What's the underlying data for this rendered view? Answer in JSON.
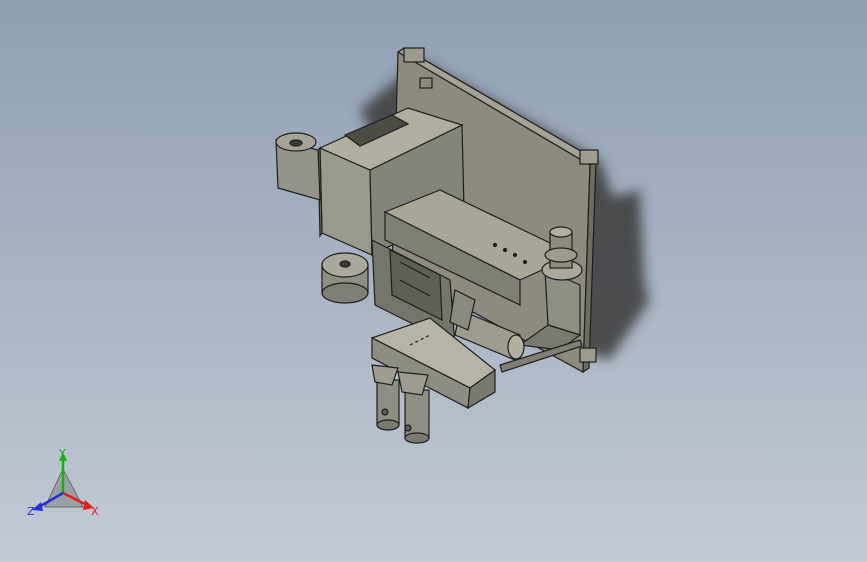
{
  "view": {
    "background_top": "#8f9fb4",
    "background_bottom": "#c2cad4",
    "part_color": "#8c8b7e",
    "edge_color": "#1e1e1e"
  },
  "triad": {
    "x_label": "X",
    "y_label": "Y",
    "z_label": "Z",
    "x_color": "#e02020",
    "y_color": "#16b016",
    "z_color": "#2030d8"
  }
}
